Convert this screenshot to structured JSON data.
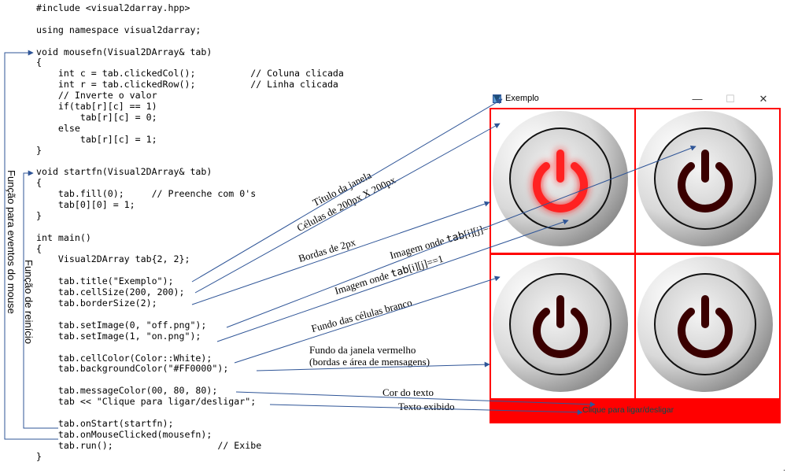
{
  "code_lines": [
    "#include <visual2darray.hpp>",
    "",
    "using namespace visual2darray;",
    "",
    "void mousefn(Visual2DArray& tab)",
    "{",
    "    int c = tab.clickedCol();          // Coluna clicada",
    "    int r = tab.clickedRow();          // Linha clicada",
    "    // Inverte o valor",
    "    if(tab[r][c] == 1)",
    "        tab[r][c] = 0;",
    "    else",
    "        tab[r][c] = 1;",
    "}",
    "",
    "void startfn(Visual2DArray& tab)",
    "{",
    "    tab.fill(0);     // Preenche com 0's",
    "    tab[0][0] = 1;",
    "}",
    "",
    "int main()",
    "{",
    "    Visual2DArray tab{2, 2};",
    "",
    "    tab.title(\"Exemplo\");",
    "    tab.cellSize(200, 200);",
    "    tab.borderSize(2);",
    "",
    "    tab.setImage(0, \"off.png\");",
    "    tab.setImage(1, \"on.png\");",
    "",
    "    tab.cellColor(Color::White);",
    "    tab.backgroundColor(\"#FF0000\");",
    "",
    "    tab.messageColor(00, 80, 80);",
    "    tab << \"Clique para ligar/desligar\";",
    "",
    "    tab.onStart(startfn);",
    "    tab.onMouseClicked(mousefn);",
    "    tab.run();                   // Exibe",
    "}"
  ],
  "side_labels": {
    "mouse_fn": "Função para eventos do mouse",
    "reset_fn": "Função de reinício"
  },
  "annotations": {
    "window_title": "Título da janela",
    "cell_size": "Células de 200px X 200px",
    "borders": "Bordas de 2px",
    "image_off_pre": "Imagem onde ",
    "image_off_code": "tab",
    "image_off_post": "[i][j]==0",
    "image_on_pre": "Imagem onde ",
    "image_on_code": "tab",
    "image_on_post": "[i][j]==1",
    "cell_bg": "Fundo das células branco",
    "window_bg_line1": "Fundo da janela vermelho",
    "window_bg_line2": "(bordas e área de mensagens)",
    "text_color": "Cor do texto",
    "text_shown": "Texto exibido"
  },
  "window": {
    "title": "Exemplo",
    "minimize": "—",
    "maximize": "☐",
    "close": "✕",
    "message": "Clique para ligar/desligar",
    "background_color": "#ff0000",
    "message_color": "#005050",
    "cell_color": "#ffffff",
    "cells": [
      {
        "state": "on"
      },
      {
        "state": "off"
      },
      {
        "state": "off"
      },
      {
        "state": "off"
      }
    ]
  },
  "colors": {
    "arrow": "#2f5597",
    "power_on": "#ff2020",
    "power_off": "#3a0000"
  },
  "corner_mark": "."
}
